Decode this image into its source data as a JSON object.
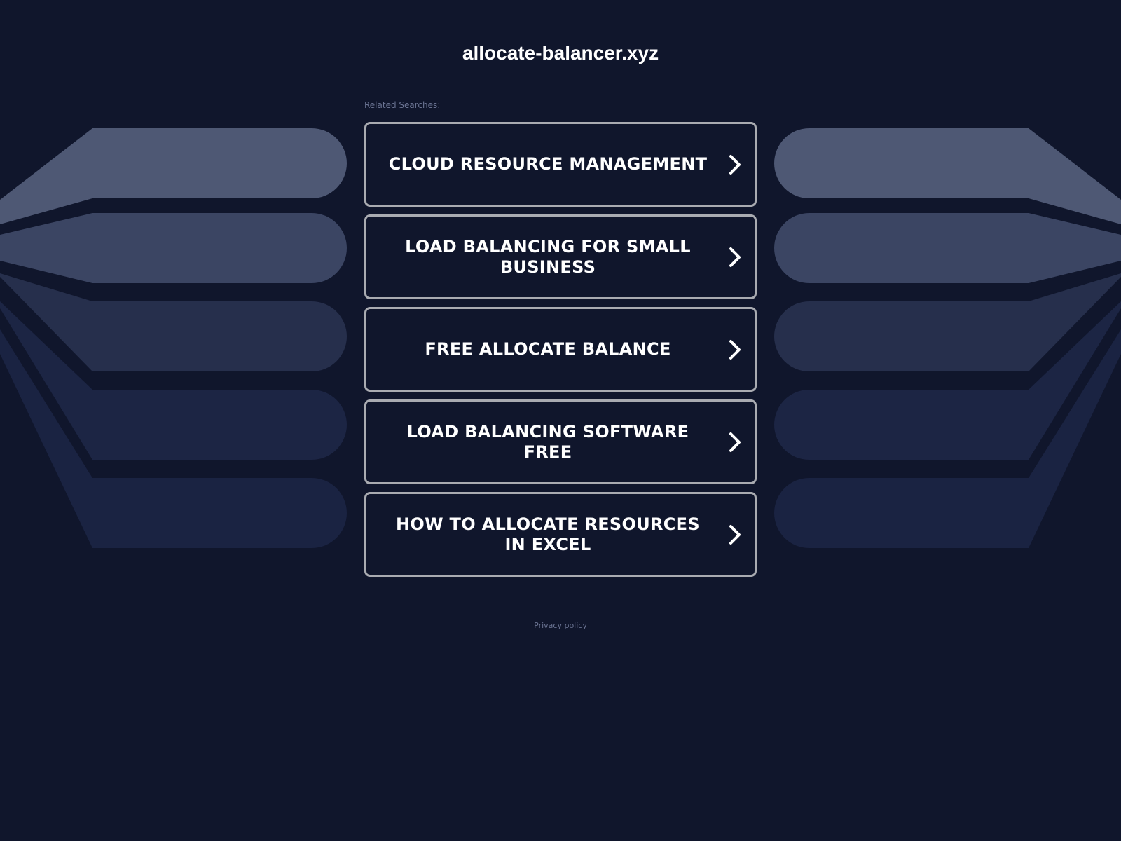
{
  "site": {
    "title": "allocate-balancer.xyz"
  },
  "related": {
    "label": "Related Searches:",
    "items": [
      {
        "label": "CLOUD RESOURCE MANAGEMENT"
      },
      {
        "label": "LOAD BALANCING FOR SMALL BUSINESS"
      },
      {
        "label": "FREE ALLOCATE BALANCE"
      },
      {
        "label": "LOAD BALANCING SOFTWARE FREE"
      },
      {
        "label": "HOW TO ALLOCATE RESOURCES IN EXCEL"
      }
    ]
  },
  "footer": {
    "privacy_label": "Privacy policy"
  },
  "colors": {
    "background": "#10162c",
    "border": "#a9abb1",
    "band_1": "#4e5874",
    "band_2": "#3b4563",
    "band_3": "#262f4c",
    "band_4": "#1c2544",
    "band_5": "#1a2342"
  },
  "icons": {
    "chevron": "chevron-right-icon"
  }
}
